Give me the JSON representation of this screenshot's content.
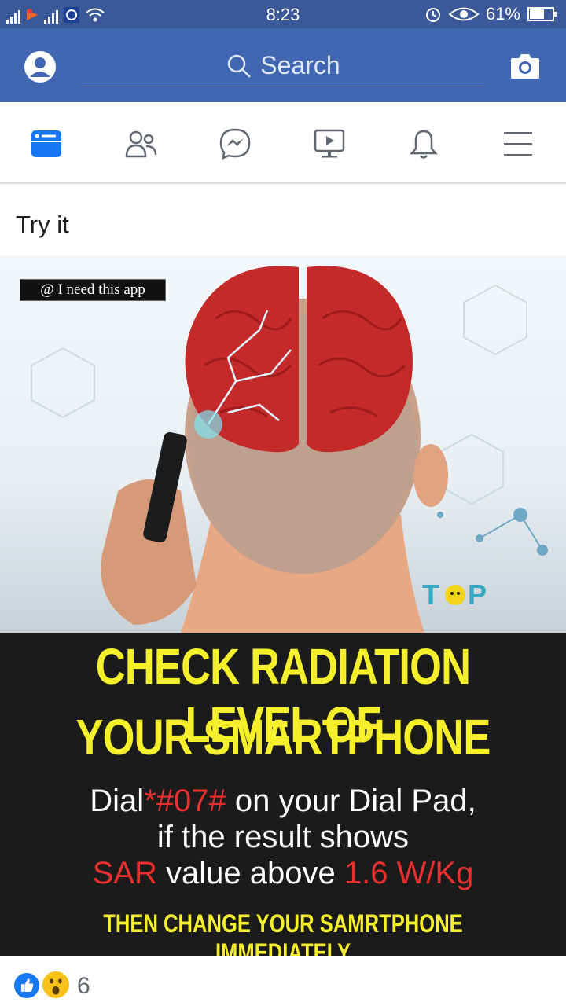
{
  "status_bar": {
    "time": "8:23",
    "battery_percent": "61%",
    "icons": [
      "signal-icon",
      "notification-icon",
      "signal-icon",
      "whatsapp-icon",
      "wifi-icon",
      "alarm-icon",
      "eye-icon",
      "battery-icon"
    ]
  },
  "app_bar": {
    "search_placeholder": "Search",
    "left_icon": "profile-icon",
    "right_icon": "camera-icon",
    "color": "#4267b2"
  },
  "nav_tabs": [
    {
      "name": "news-feed",
      "icon": "news-feed-icon",
      "active": true
    },
    {
      "name": "friends",
      "icon": "friends-icon",
      "active": false
    },
    {
      "name": "messenger",
      "icon": "messenger-icon",
      "active": false
    },
    {
      "name": "watch",
      "icon": "watch-icon",
      "active": false
    },
    {
      "name": "notifications",
      "icon": "bell-icon",
      "active": false
    },
    {
      "name": "menu",
      "icon": "menu-icon",
      "active": false
    }
  ],
  "post": {
    "text": "Try it",
    "image": {
      "tag": "@ I need this app",
      "logo": "TOP",
      "headline_1": "CHECK RADIATION LEVEL OF",
      "headline_2": "YOUR SMARTPHONE",
      "line1_a": "Dial",
      "line1_code": "*#07#",
      "line1_b": "on your Dial Pad,",
      "line2": "if the result shows",
      "line3_a": "SAR",
      "line3_b": "value above",
      "line3_c": "1.6 W/Kg",
      "footer": "THEN CHANGE YOUR SAMRTPHONE IMMEDIATELY"
    },
    "reactions": {
      "count": "6",
      "types": [
        "like-icon",
        "wow-icon"
      ]
    }
  }
}
